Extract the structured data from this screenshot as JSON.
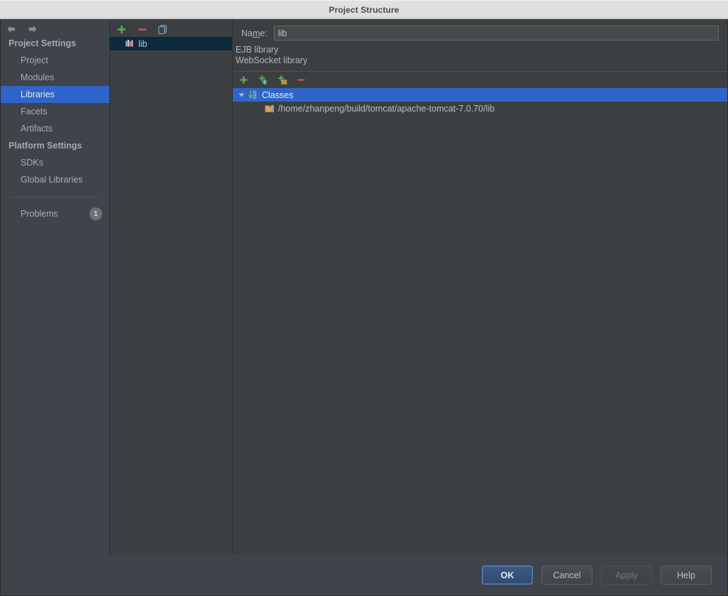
{
  "window": {
    "title": "Project Structure"
  },
  "nav": {
    "back_icon": "arrow-left-icon",
    "forward_icon": "arrow-right-icon"
  },
  "sidebar": {
    "groups": [
      {
        "label": "Project Settings",
        "items": [
          {
            "label": "Project",
            "selected": false
          },
          {
            "label": "Modules",
            "selected": false
          },
          {
            "label": "Libraries",
            "selected": true
          },
          {
            "label": "Facets",
            "selected": false
          },
          {
            "label": "Artifacts",
            "selected": false
          }
        ]
      },
      {
        "label": "Platform Settings",
        "items": [
          {
            "label": "SDKs",
            "selected": false
          },
          {
            "label": "Global Libraries",
            "selected": false
          }
        ]
      }
    ],
    "problems": {
      "label": "Problems",
      "badge": "1"
    },
    "selected_color": "#2f65ca"
  },
  "middle_panel": {
    "toolbar": [
      {
        "name": "add-library-button",
        "icon": "plus-icon",
        "color": "#5aa85a"
      },
      {
        "name": "remove-library-button",
        "icon": "minus-icon",
        "color": "#c8584f"
      },
      {
        "name": "copy-library-button",
        "icon": "copy-icon",
        "color": "#6f9fc4"
      }
    ],
    "libraries": [
      {
        "label": "lib",
        "selected": true,
        "icon": "library-books-icon"
      }
    ]
  },
  "right_panel": {
    "name_field": {
      "label_prefix": "Na",
      "label_mnemonic": "m",
      "label_suffix": "e:",
      "value": "lib",
      "placeholder": ""
    },
    "library_types": [
      "EJB library",
      "WebSocket library"
    ],
    "toolbar": [
      {
        "name": "add-root-button",
        "icon": "plus-icon",
        "color": "#5aa85a"
      },
      {
        "name": "attach-url-button",
        "icon": "plus-globe-icon",
        "color": "#5aa85a"
      },
      {
        "name": "attach-jar-dirs-button",
        "icon": "plus-archive-icon",
        "color": "#5aa85a"
      },
      {
        "name": "remove-root-button",
        "icon": "minus-icon",
        "color": "#c8584f"
      }
    ],
    "tree": {
      "root": {
        "label": "Classes",
        "icon": "classes-binary-icon",
        "expanded": true,
        "selected": true,
        "toggle_icon": "triangle-down-icon"
      },
      "children": [
        {
          "label": "/home/zhanpeng/build/tomcat/apache-tomcat-7.0.70/lib",
          "icon": "folder-jar-icon",
          "selected": false
        }
      ]
    }
  },
  "buttons": {
    "ok": "OK",
    "cancel": "Cancel",
    "apply": "Apply",
    "help": "Help"
  }
}
